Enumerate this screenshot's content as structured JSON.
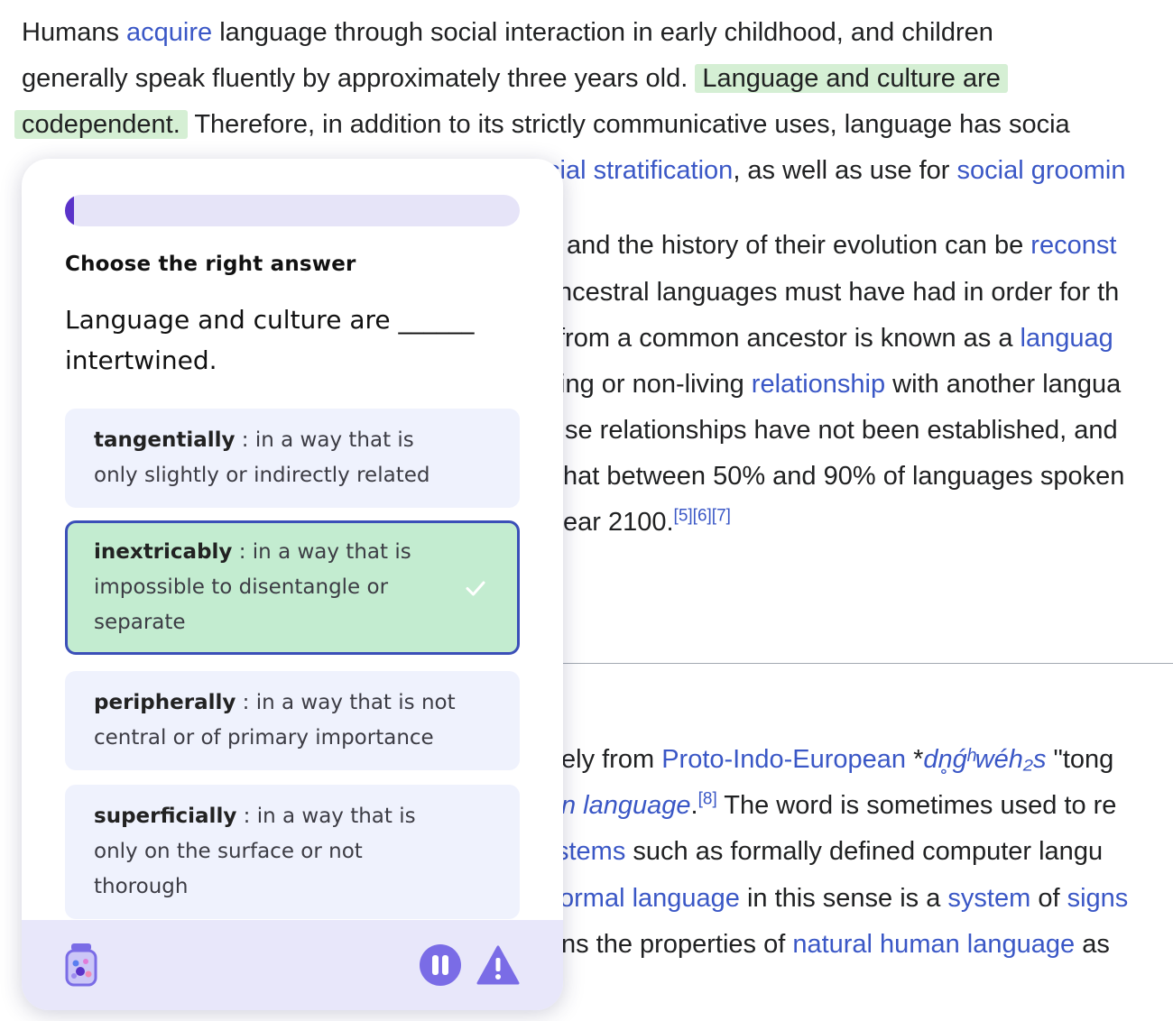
{
  "article": {
    "l1": {
      "a": "Humans ",
      "link": "acquire",
      "b": " language through social interaction in early childhood, and children"
    },
    "l2": {
      "a": "generally speak fluently by approximately three years old. ",
      "hl": "Language and culture are"
    },
    "l3": {
      "hl": "codependent.",
      "a": " Therefore, in addition to its strictly communicative uses, language has socia"
    },
    "l4": {
      "link1": "cial stratification",
      "a": ", as well as use for ",
      "link2": "social groomin"
    },
    "l5": {
      "a": " and the history of their evolution can be ",
      "link": "reconst"
    },
    "l6": {
      "a": "ncestral languages must have had in order for th"
    },
    "l7": {
      "a": "from a common ancestor is known as a ",
      "link": "languag"
    },
    "l8": {
      "a": "ing or non-living ",
      "link": "relationship",
      "b": " with another langua"
    },
    "l9": {
      "a": "se relationships have not been established, and"
    },
    "l10": {
      "a": "hat between 50% and 90% of languages spoken"
    },
    "l11": {
      "a": "ear 2100.",
      "sup": "[5][6][7]"
    },
    "l12": {
      "a": "ely from ",
      "link": "Proto-Indo-European",
      "b": " *",
      "ital": "dn̥ǵʰwéh₂s",
      "c": " \"tong"
    },
    "l13": {
      "ital": "n language",
      "a": ".",
      "sup": "[8]",
      "b": " The word is sometimes used to re"
    },
    "l14": {
      "link": "stems",
      "a": " such as formally defined computer langu"
    },
    "l15": {
      "link1": "ormal language",
      "a": " in this sense is a ",
      "link2": "system",
      "b": " of ",
      "link3": "signs"
    },
    "l16": {
      "a": "ns the properties of ",
      "link": "natural human language",
      "b": " as"
    }
  },
  "quiz": {
    "progress": 0.02,
    "accent": "#5a33c9",
    "prompt": "Choose the right answer",
    "question": "Language and culture are ______ intertwined.",
    "options": [
      {
        "word": "tangentially",
        "def": " : in a way that is only slightly or indirectly related",
        "selected": false
      },
      {
        "word": "inextricably",
        "def": " : in a way that is impossible to disentangle or separate",
        "selected": true
      },
      {
        "word": "peripherally",
        "def": " : in a way that is not central or of primary importance",
        "selected": false
      },
      {
        "word": "superficially",
        "def": " : in a way that is only on the surface or not thorough",
        "selected": false
      }
    ],
    "icons": {
      "jar": "jar-icon",
      "pause": "pause-icon",
      "warning": "warning-icon",
      "check": "check-icon"
    }
  }
}
